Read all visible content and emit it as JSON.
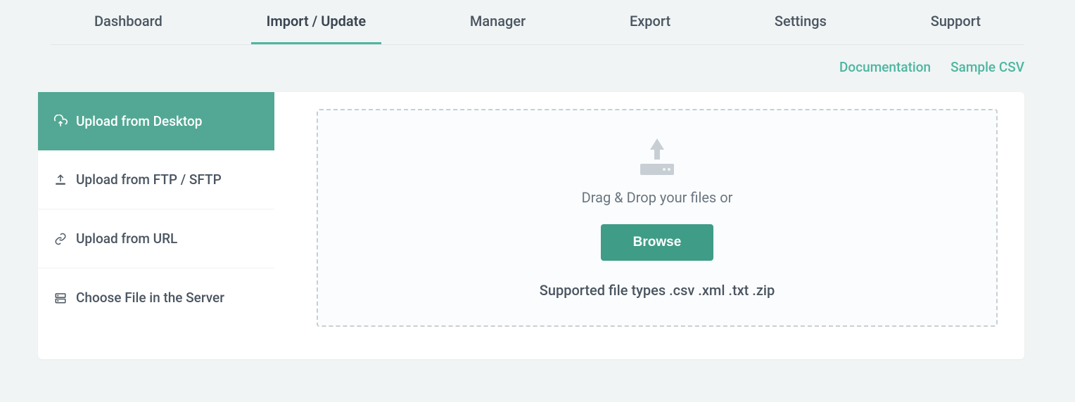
{
  "tabs": [
    {
      "label": "Dashboard",
      "active": false
    },
    {
      "label": "Import / Update",
      "active": true
    },
    {
      "label": "Manager",
      "active": false
    },
    {
      "label": "Export",
      "active": false
    },
    {
      "label": "Settings",
      "active": false
    },
    {
      "label": "Support",
      "active": false
    }
  ],
  "links": {
    "documentation": "Documentation",
    "sample_csv": "Sample CSV"
  },
  "sidebar": {
    "items": [
      {
        "label": "Upload from Desktop",
        "icon": "cloud-upload",
        "active": true
      },
      {
        "label": "Upload from FTP / SFTP",
        "icon": "ftp-upload",
        "active": false
      },
      {
        "label": "Upload from URL",
        "icon": "link",
        "active": false
      },
      {
        "label": "Choose File in the Server",
        "icon": "server",
        "active": false
      }
    ]
  },
  "dropzone": {
    "drag_text": "Drag & Drop your files or",
    "browse_label": "Browse",
    "supported_text": "Supported file types .csv .xml .txt .zip"
  }
}
